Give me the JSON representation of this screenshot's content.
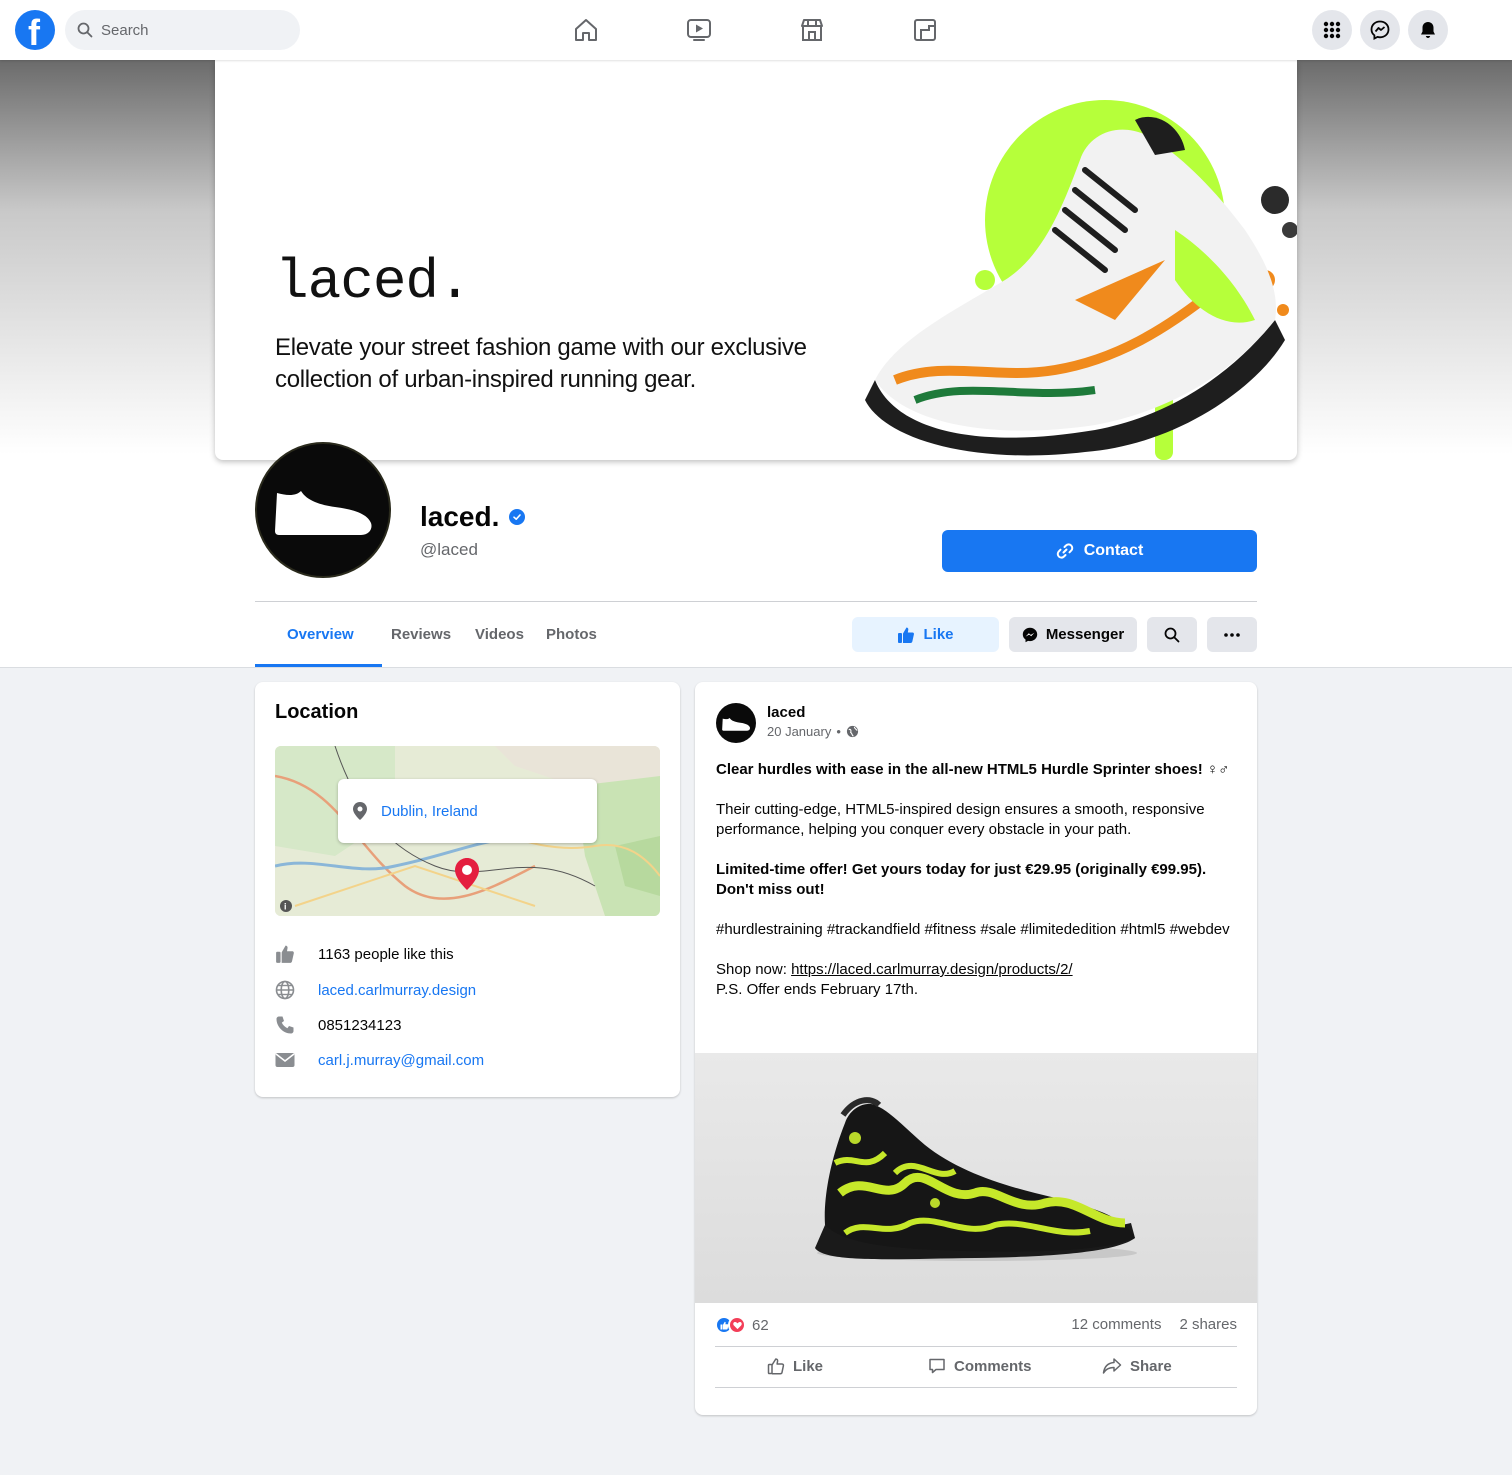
{
  "nav": {
    "search_placeholder": "Search",
    "icons": [
      "home-icon",
      "watch-icon",
      "marketplace-icon",
      "gaming-icon"
    ],
    "right_icons": [
      "menu-grid-icon",
      "messenger-icon",
      "notifications-icon"
    ]
  },
  "cover": {
    "brand": "laced.",
    "tagline": "Elevate your street fashion game with our exclusive collection of urban-inspired running gear."
  },
  "page": {
    "name": "laced.",
    "handle": "@laced",
    "contact_label": "Contact"
  },
  "tabs": [
    {
      "label": "Overview",
      "active": true
    },
    {
      "label": "Reviews"
    },
    {
      "label": "Videos"
    },
    {
      "label": "Photos"
    }
  ],
  "actions": {
    "like": "Like",
    "messenger": "Messenger"
  },
  "location": {
    "title": "Location",
    "map_place": "Dublin, Ireland",
    "likes": "1163 people like this",
    "website": "laced.carlmurray.design",
    "phone": "0851234123",
    "email": "carl.j.murray@gmail.com"
  },
  "post": {
    "author": "laced",
    "date": "20 January",
    "headline": "Clear hurdles with ease in the all-new HTML5 Hurdle Sprinter shoes! ♀♂",
    "paragraph": "Their cutting-edge, HTML5-inspired design ensures a smooth, responsive performance, helping you conquer every obstacle in your path.",
    "offer": "Limited-time offer! Get yours today for just €29.95 (originally €99.95). Don't miss out!",
    "hashtags": "#hurdlestraining #trackandfield #fitness #sale #limitededition #html5 #webdev",
    "shop_prefix": "Shop now: ",
    "shop_link": "https://laced.carlmurray.design/products/2/",
    "ps": "P.S. Offer ends February 17th.",
    "reactions": "62",
    "comments": "12 comments",
    "shares": "2 shares",
    "like_label": "Like",
    "comment_label": "Comments",
    "share_label": "Share"
  },
  "colors": {
    "brand_blue": "#1877f2",
    "accent_green": "#b6ff3a",
    "accent_orange": "#f08a1c"
  }
}
